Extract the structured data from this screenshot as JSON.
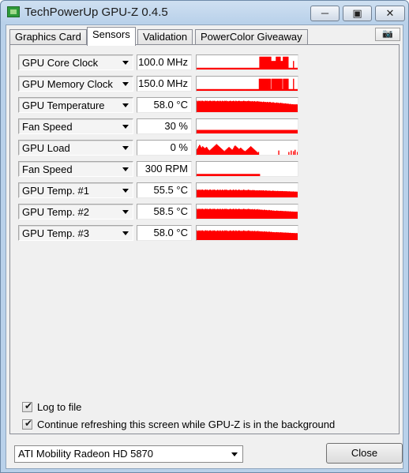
{
  "window": {
    "title": "TechPowerUp GPU-Z 0.4.5",
    "minimize_icon": "minimize-icon",
    "maximize_icon": "maximize-icon",
    "close_icon": "close-icon",
    "minimize_glyph": "─",
    "maximize_glyph": "▣",
    "close_glyph": "✕"
  },
  "tabs": [
    {
      "label": "Graphics Card",
      "active": false
    },
    {
      "label": "Sensors",
      "active": true
    },
    {
      "label": "Validation",
      "active": false
    },
    {
      "label": "PowerColor Giveaway",
      "active": false
    }
  ],
  "camera": {
    "icon": "camera-icon",
    "glyph": "📷"
  },
  "sensors": [
    {
      "label": "GPU Core Clock",
      "value": "100.0 MHz",
      "graph": [
        0.12,
        0.12,
        0.12,
        0.12,
        0.12,
        0.12,
        0.12,
        0.12,
        0.12,
        0.12,
        0.12,
        0.12,
        0.12,
        0.12,
        0.12,
        0.12,
        0.12,
        0.12,
        0.12,
        0.12,
        0.12,
        0.12,
        0.12,
        0.12,
        0.12,
        0.12,
        0.12,
        0.12,
        0.12,
        0.12,
        0.12,
        0.12,
        0.12,
        0.12,
        0.12,
        0.12,
        0.12,
        0.12,
        0.12,
        0.12,
        0.12,
        0.12,
        0.12,
        0.12,
        0.12,
        0.12,
        0.12,
        0.12,
        0.12,
        0.12,
        0.12,
        0.12,
        0.12,
        0.12,
        0.12,
        0.12,
        0.12,
        0.12,
        0.12,
        0.12,
        0.12,
        0.12,
        0.12,
        0.12,
        0.12,
        0.12,
        0.12,
        0.12,
        0.12,
        0.12,
        0.12,
        0.12,
        0.12,
        0.12,
        0.12,
        0.12,
        0.12,
        0.12,
        0.12,
        0.12,
        0.9,
        0.9,
        0.9,
        0.9,
        0.9,
        0.9,
        0.9,
        0.9,
        0.9,
        0.9,
        0.9,
        0.9,
        0.9,
        0.9,
        0.9,
        0.6,
        0.6,
        0.6,
        0.6,
        0.6,
        0.6,
        0.9,
        0.9,
        0.9,
        0.9,
        0.9,
        0.9,
        0.6,
        0.6,
        0.6,
        0.9,
        0.9,
        0.9,
        0.9,
        0.9,
        0.9,
        0.9,
        0.12,
        0.12,
        0.12,
        0.12,
        0.12,
        0.12,
        0.6,
        0.12,
        0.12,
        0.12,
        0.12,
        0.12
      ]
    },
    {
      "label": "GPU Memory Clock",
      "value": "150.0 MHz",
      "graph": [
        0.12,
        0.12,
        0.12,
        0.12,
        0.12,
        0.12,
        0.12,
        0.12,
        0.12,
        0.12,
        0.12,
        0.12,
        0.12,
        0.12,
        0.12,
        0.12,
        0.12,
        0.12,
        0.12,
        0.12,
        0.12,
        0.12,
        0.12,
        0.12,
        0.12,
        0.12,
        0.12,
        0.12,
        0.12,
        0.12,
        0.12,
        0.12,
        0.12,
        0.12,
        0.12,
        0.12,
        0.12,
        0.12,
        0.12,
        0.12,
        0.12,
        0.12,
        0.12,
        0.12,
        0.12,
        0.12,
        0.12,
        0.12,
        0.12,
        0.12,
        0.12,
        0.12,
        0.12,
        0.12,
        0.12,
        0.12,
        0.12,
        0.12,
        0.12,
        0.12,
        0.12,
        0.12,
        0.12,
        0.12,
        0.12,
        0.12,
        0.12,
        0.12,
        0.12,
        0.12,
        0.12,
        0.12,
        0.12,
        0.12,
        0.12,
        0.12,
        0.12,
        0.12,
        0.12,
        0.12,
        0.85,
        0.85,
        0.85,
        0.85,
        0.85,
        0.85,
        0.85,
        0.85,
        0.85,
        0.85,
        0.85,
        0.85,
        0.85,
        0.85,
        0.85,
        0.12,
        0.85,
        0.85,
        0.85,
        0.85,
        0.85,
        0.85,
        0.85,
        0.85,
        0.85,
        0.85,
        0.85,
        0.85,
        0.85,
        0.85,
        0.12,
        0.85,
        0.85,
        0.85,
        0.85,
        0.85,
        0.85,
        0.85,
        0.12,
        0.12,
        0.12,
        0.12,
        0.12,
        0.12,
        0.85,
        0.12,
        0.12,
        0.12,
        0.12,
        0.12
      ]
    },
    {
      "label": "GPU Temperature",
      "value": "58.0 °C",
      "graph": [
        0.8,
        0.75,
        0.8,
        0.78,
        0.8,
        0.76,
        0.8,
        0.8,
        0.78,
        0.75,
        0.8,
        0.8,
        0.78,
        0.8,
        0.76,
        0.78,
        0.8,
        0.8,
        0.78,
        0.76,
        0.8,
        0.78,
        0.8,
        0.78,
        0.75,
        0.78,
        0.8,
        0.78,
        0.76,
        0.8,
        0.78,
        0.75,
        0.8,
        0.78,
        0.76,
        0.8,
        0.78,
        0.8,
        0.76,
        0.78,
        0.75,
        0.78,
        0.8,
        0.78,
        0.76,
        0.78,
        0.8,
        0.78,
        0.75,
        0.8,
        0.78,
        0.76,
        0.78,
        0.8,
        0.78,
        0.76,
        0.78,
        0.75,
        0.78,
        0.8,
        0.78,
        0.76,
        0.78,
        0.75,
        0.78,
        0.8,
        0.76,
        0.78,
        0.75,
        0.76,
        0.78,
        0.74,
        0.76,
        0.78,
        0.72,
        0.76,
        0.74,
        0.78,
        0.72,
        0.75,
        0.72,
        0.74,
        0.72,
        0.7,
        0.74,
        0.72,
        0.7,
        0.72,
        0.68,
        0.72,
        0.7,
        0.68,
        0.72,
        0.7,
        0.68,
        0.66,
        0.7,
        0.68,
        0.66,
        0.64,
        0.66,
        0.68,
        0.64,
        0.66,
        0.62,
        0.64,
        0.66,
        0.62,
        0.64,
        0.6,
        0.62,
        0.6,
        0.62,
        0.6,
        0.58,
        0.6,
        0.58,
        0.56,
        0.58,
        0.56,
        0.55,
        0.56,
        0.55,
        0.54,
        0.55,
        0.54,
        0.55,
        0.54
      ]
    },
    {
      "label": "Fan Speed",
      "value": "30 %",
      "graph": [
        0.25,
        0.25,
        0.25,
        0.25,
        0.25,
        0.25,
        0.25,
        0.25,
        0.25,
        0.25,
        0.25,
        0.25,
        0.25,
        0.25,
        0.25,
        0.25,
        0.25,
        0.25,
        0.25,
        0.25,
        0.25,
        0.25,
        0.25,
        0.25,
        0.25,
        0.25,
        0.25,
        0.25,
        0.25,
        0.25,
        0.25,
        0.25,
        0.25,
        0.25,
        0.25,
        0.25,
        0.25,
        0.25,
        0.25,
        0.25,
        0.25,
        0.25,
        0.25,
        0.25,
        0.25,
        0.25,
        0.25,
        0.25,
        0.25,
        0.25,
        0.25,
        0.25,
        0.25,
        0.25,
        0.25,
        0.25,
        0.25,
        0.25,
        0.25,
        0.25,
        0.25,
        0.25,
        0.25,
        0.25,
        0.25,
        0.25,
        0.25,
        0.25,
        0.25,
        0.25,
        0.25,
        0.25,
        0.25,
        0.25,
        0.25,
        0.25,
        0.25,
        0.25,
        0.25,
        0.25,
        0.25,
        0.25,
        0.25,
        0.25,
        0.25,
        0.25,
        0.25,
        0.25,
        0.25,
        0.25,
        0.25,
        0.25,
        0.25,
        0.25,
        0.25,
        0.25,
        0.25,
        0.25,
        0.25,
        0.25,
        0.25,
        0.25,
        0.25,
        0.25,
        0.25,
        0.25,
        0.25,
        0.25,
        0.25,
        0.25,
        0.25,
        0.25,
        0.25,
        0.25,
        0.25,
        0.25,
        0.25,
        0.25,
        0.25,
        0.25,
        0.25,
        0.25,
        0.25,
        0.25,
        0.25,
        0.25,
        0.25,
        0.25
      ]
    },
    {
      "label": "GPU Load",
      "value": "0 %",
      "graph": [
        0.4,
        0.5,
        0.6,
        0.7,
        0.65,
        0.55,
        0.5,
        0.6,
        0.55,
        0.5,
        0.45,
        0.5,
        0.55,
        0.5,
        0.4,
        0.35,
        0.3,
        0.35,
        0.4,
        0.45,
        0.5,
        0.55,
        0.6,
        0.65,
        0.7,
        0.75,
        0.7,
        0.65,
        0.6,
        0.55,
        0.5,
        0.45,
        0.4,
        0.35,
        0.3,
        0.25,
        0.3,
        0.35,
        0.4,
        0.45,
        0.5,
        0.55,
        0.5,
        0.45,
        0.4,
        0.35,
        0.4,
        0.5,
        0.6,
        0.65,
        0.6,
        0.55,
        0.5,
        0.45,
        0.4,
        0.45,
        0.5,
        0.45,
        0.4,
        0.35,
        0.3,
        0.28,
        0.25,
        0.3,
        0.35,
        0.4,
        0.45,
        0.5,
        0.55,
        0.6,
        0.55,
        0.5,
        0.45,
        0.4,
        0.35,
        0.3,
        0.25,
        0.2,
        0.15,
        0.2,
        0,
        0,
        0,
        0,
        0,
        0,
        0,
        0,
        0,
        0,
        0,
        0,
        0,
        0,
        0,
        0,
        0,
        0,
        0,
        0,
        0,
        0,
        0,
        0,
        0,
        0.3,
        0,
        0,
        0,
        0,
        0,
        0,
        0,
        0,
        0,
        0,
        0,
        0,
        0.2,
        0,
        0,
        0.3,
        0,
        0,
        0.25,
        0,
        0.35,
        0,
        0,
        0.2
      ]
    },
    {
      "label": "Fan Speed",
      "value": "300 RPM",
      "graph": [
        0.15,
        0.15,
        0.15,
        0.15,
        0.15,
        0.15,
        0.15,
        0.15,
        0.15,
        0.15,
        0.15,
        0.15,
        0.15,
        0.15,
        0.15,
        0.15,
        0.15,
        0.15,
        0.15,
        0.15,
        0.15,
        0.15,
        0.15,
        0.15,
        0.15,
        0.15,
        0.15,
        0.15,
        0.15,
        0.15,
        0.15,
        0.15,
        0.15,
        0.15,
        0.15,
        0.15,
        0.15,
        0.15,
        0.15,
        0.15,
        0.15,
        0.15,
        0.15,
        0.15,
        0.15,
        0.15,
        0.15,
        0.15,
        0.15,
        0.15,
        0.15,
        0.15,
        0.15,
        0.15,
        0.15,
        0.15,
        0.15,
        0.15,
        0.15,
        0.15,
        0.15,
        0.15,
        0.15,
        0.15,
        0.15,
        0.15,
        0.15,
        0.15,
        0.15,
        0.15,
        0.15,
        0.15,
        0.15,
        0.15,
        0.15,
        0.15,
        0.15,
        0.15,
        0.15,
        0.15,
        0,
        0,
        0,
        0,
        0,
        0,
        0,
        0,
        0,
        0,
        0,
        0,
        0,
        0,
        0,
        0,
        0,
        0,
        0,
        0,
        0,
        0,
        0,
        0,
        0,
        0,
        0,
        0,
        0,
        0,
        0,
        0,
        0,
        0,
        0,
        0,
        0,
        0,
        0,
        0,
        0,
        0,
        0,
        0,
        0,
        0,
        0,
        0
      ]
    },
    {
      "label": "GPU Temp. #1",
      "value": "55.5 °C",
      "graph": [
        0.55,
        0.5,
        0.55,
        0.52,
        0.55,
        0.5,
        0.55,
        0.55,
        0.52,
        0.5,
        0.55,
        0.55,
        0.52,
        0.55,
        0.5,
        0.52,
        0.55,
        0.55,
        0.52,
        0.5,
        0.55,
        0.52,
        0.55,
        0.52,
        0.5,
        0.52,
        0.55,
        0.52,
        0.5,
        0.55,
        0.52,
        0.5,
        0.55,
        0.52,
        0.5,
        0.55,
        0.52,
        0.55,
        0.5,
        0.52,
        0.5,
        0.52,
        0.55,
        0.52,
        0.5,
        0.52,
        0.55,
        0.52,
        0.5,
        0.55,
        0.52,
        0.5,
        0.52,
        0.55,
        0.52,
        0.5,
        0.52,
        0.5,
        0.52,
        0.55,
        0.52,
        0.5,
        0.52,
        0.5,
        0.52,
        0.55,
        0.5,
        0.52,
        0.5,
        0.5,
        0.52,
        0.5,
        0.52,
        0.5,
        0.48,
        0.5,
        0.48,
        0.5,
        0.48,
        0.5,
        0.5,
        0.48,
        0.5,
        0.48,
        0.5,
        0.48,
        0.46,
        0.5,
        0.48,
        0.46,
        0.48,
        0.46,
        0.48,
        0.46,
        0.45,
        0.46,
        0.48,
        0.46,
        0.45,
        0.46,
        0.44,
        0.45,
        0.46,
        0.44,
        0.45,
        0.44,
        0.45,
        0.44,
        0.45,
        0.44,
        0.43,
        0.44,
        0.43,
        0.44,
        0.42,
        0.43,
        0.42,
        0.43,
        0.42,
        0.41,
        0.42,
        0.41,
        0.42,
        0.41,
        0.4,
        0.41,
        0.4,
        0.4
      ]
    },
    {
      "label": "GPU Temp. #2",
      "value": "58.5 °C",
      "graph": [
        0.7,
        0.65,
        0.7,
        0.68,
        0.7,
        0.66,
        0.7,
        0.7,
        0.68,
        0.65,
        0.7,
        0.7,
        0.68,
        0.7,
        0.66,
        0.68,
        0.7,
        0.7,
        0.68,
        0.66,
        0.7,
        0.68,
        0.7,
        0.68,
        0.65,
        0.68,
        0.7,
        0.68,
        0.66,
        0.7,
        0.68,
        0.65,
        0.7,
        0.68,
        0.66,
        0.7,
        0.68,
        0.7,
        0.66,
        0.68,
        0.65,
        0.68,
        0.7,
        0.68,
        0.66,
        0.68,
        0.7,
        0.68,
        0.65,
        0.7,
        0.68,
        0.66,
        0.68,
        0.7,
        0.68,
        0.66,
        0.68,
        0.65,
        0.68,
        0.7,
        0.68,
        0.66,
        0.68,
        0.65,
        0.68,
        0.7,
        0.66,
        0.68,
        0.65,
        0.66,
        0.68,
        0.64,
        0.66,
        0.68,
        0.62,
        0.66,
        0.64,
        0.68,
        0.62,
        0.65,
        0.64,
        0.62,
        0.64,
        0.62,
        0.6,
        0.64,
        0.62,
        0.6,
        0.62,
        0.6,
        0.58,
        0.62,
        0.6,
        0.58,
        0.6,
        0.58,
        0.56,
        0.58,
        0.56,
        0.55,
        0.56,
        0.58,
        0.55,
        0.56,
        0.54,
        0.55,
        0.56,
        0.54,
        0.55,
        0.53,
        0.54,
        0.53,
        0.54,
        0.53,
        0.52,
        0.53,
        0.52,
        0.51,
        0.52,
        0.51,
        0.5,
        0.51,
        0.5,
        0.5,
        0.5,
        0.49,
        0.5,
        0.49
      ]
    },
    {
      "label": "GPU Temp. #3",
      "value": "58.0 °C",
      "graph": [
        0.68,
        0.62,
        0.68,
        0.65,
        0.68,
        0.63,
        0.68,
        0.68,
        0.65,
        0.62,
        0.68,
        0.68,
        0.65,
        0.68,
        0.63,
        0.65,
        0.68,
        0.68,
        0.65,
        0.63,
        0.68,
        0.65,
        0.68,
        0.65,
        0.62,
        0.65,
        0.68,
        0.65,
        0.63,
        0.68,
        0.65,
        0.62,
        0.68,
        0.65,
        0.63,
        0.68,
        0.65,
        0.68,
        0.63,
        0.65,
        0.62,
        0.65,
        0.68,
        0.65,
        0.63,
        0.65,
        0.68,
        0.65,
        0.62,
        0.68,
        0.65,
        0.63,
        0.65,
        0.68,
        0.65,
        0.63,
        0.65,
        0.62,
        0.65,
        0.68,
        0.65,
        0.63,
        0.65,
        0.62,
        0.65,
        0.68,
        0.63,
        0.65,
        0.62,
        0.63,
        0.65,
        0.61,
        0.63,
        0.65,
        0.6,
        0.63,
        0.61,
        0.65,
        0.6,
        0.62,
        0.61,
        0.6,
        0.61,
        0.6,
        0.58,
        0.61,
        0.6,
        0.58,
        0.6,
        0.58,
        0.56,
        0.6,
        0.58,
        0.56,
        0.58,
        0.56,
        0.55,
        0.56,
        0.55,
        0.54,
        0.55,
        0.56,
        0.54,
        0.55,
        0.53,
        0.54,
        0.55,
        0.53,
        0.54,
        0.52,
        0.53,
        0.52,
        0.53,
        0.52,
        0.51,
        0.52,
        0.51,
        0.5,
        0.51,
        0.5,
        0.49,
        0.5,
        0.49,
        0.49,
        0.49,
        0.48,
        0.49,
        0.48
      ]
    }
  ],
  "graph_color": "#ff0000",
  "options": {
    "log_to_file": {
      "label": "Log to file",
      "checked": true
    },
    "continue_refreshing": {
      "label": "Continue refreshing this screen while GPU-Z is in the background",
      "checked": true
    },
    "check_glyph": "✔"
  },
  "gpu_select": {
    "value": "ATI Mobility Radeon HD 5870"
  },
  "close_label": "Close"
}
